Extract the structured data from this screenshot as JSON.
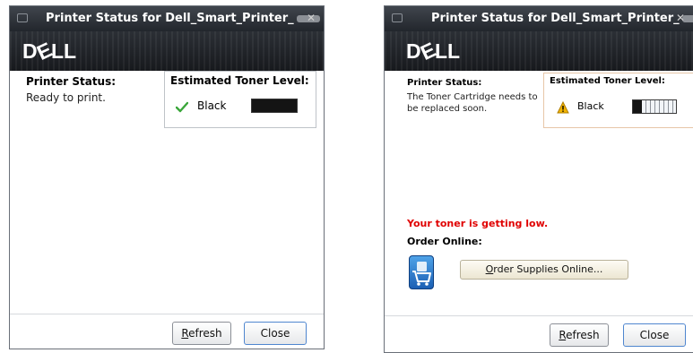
{
  "colors": {
    "titlebar": "#2b2f35",
    "error_text": "#e00000",
    "ok_icon": "#3aa63a",
    "warn_icon": "#f2b400",
    "toner_black": "#141414"
  },
  "left_window": {
    "title": "Printer Status for Dell_Smart_Printer_",
    "logo": "DELL",
    "status_label": "Printer Status:",
    "status_text": "Ready to print.",
    "toner_title": "Estimated Toner Level:",
    "toner_color": "Black",
    "toner_level": 1.0,
    "toner_status_icon": "check-icon",
    "refresh_label": "Refresh",
    "close_label": "Close"
  },
  "right_window": {
    "title": "Printer Status for Dell_Smart_Printer_",
    "logo": "DELL",
    "status_label": "Printer Status:",
    "status_text_line1": "The Toner Cartridge needs to",
    "status_text_line2": "be replaced soon.",
    "toner_title": "Estimated Toner Level:",
    "toner_color": "Black",
    "toner_level": 0.2,
    "toner_status_icon": "warning-icon",
    "low_message": "Your toner is getting low.",
    "order_label": "Order Online:",
    "order_button_label": "Order Supplies Online...",
    "refresh_label": "Refresh",
    "close_label": "Close"
  }
}
